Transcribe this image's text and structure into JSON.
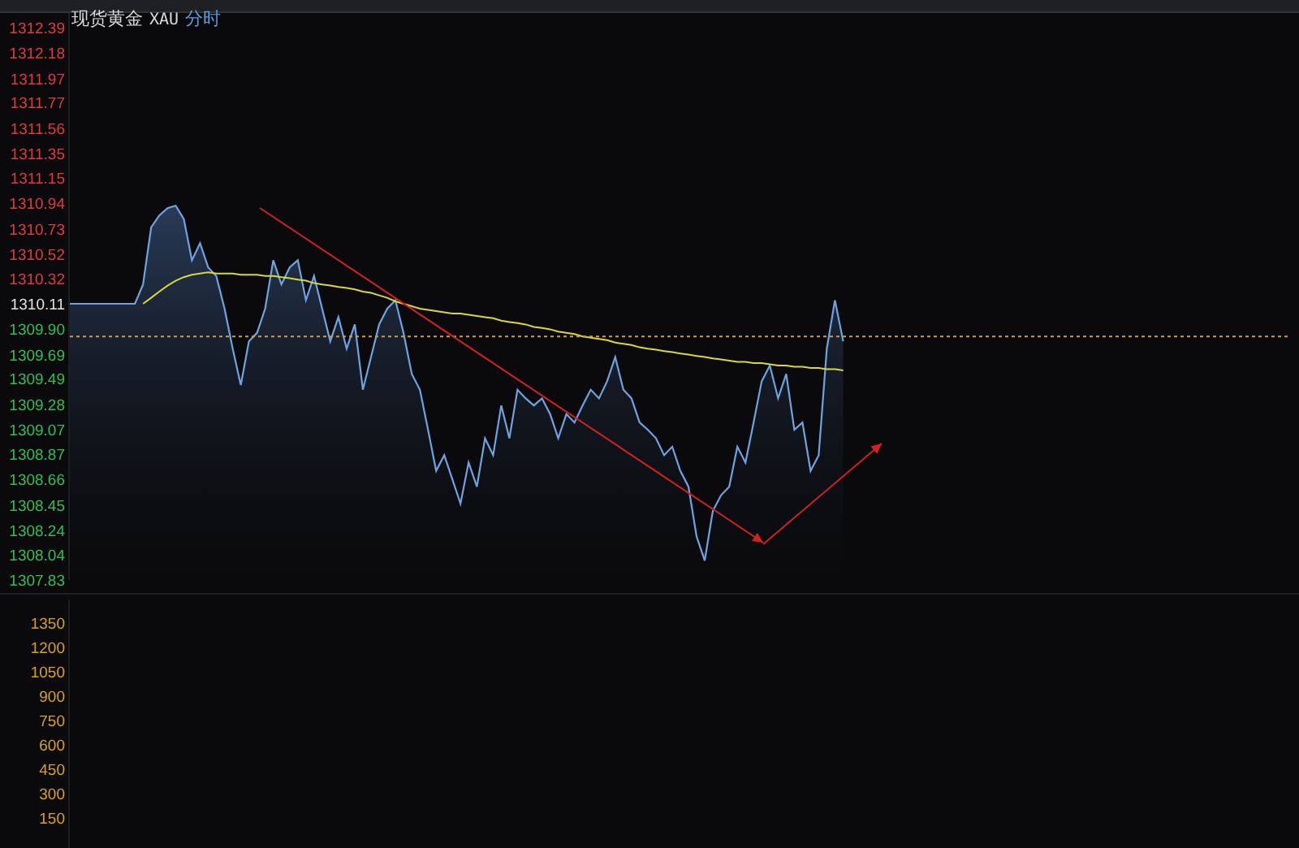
{
  "header": {
    "instrument": "现货黄金",
    "code": "XAU",
    "period": "分时"
  },
  "price_chart": {
    "chart_data": {
      "type": "line",
      "ylim": [
        1307.83,
        1312.39
      ],
      "categories": [
        null,
        null,
        null,
        null,
        null,
        null,
        null,
        null,
        null,
        null,
        null,
        null,
        null,
        null,
        null,
        null,
        null,
        null,
        null,
        null,
        null,
        null,
        null,
        null,
        null,
        null,
        null,
        null,
        null,
        null,
        null,
        null,
        null,
        null,
        null,
        null,
        null,
        null,
        null,
        null,
        null,
        null,
        null,
        null,
        null,
        null,
        null,
        null,
        null,
        null,
        null,
        null,
        null,
        null,
        null,
        null,
        null,
        null,
        null,
        null,
        null,
        null,
        null,
        null,
        null,
        null,
        null,
        null,
        null,
        null,
        null,
        null,
        null,
        null,
        null,
        null,
        null,
        null,
        null,
        null,
        null,
        null,
        null,
        null,
        null,
        null,
        null,
        null,
        null,
        null,
        null,
        null,
        null,
        null,
        null,
        null,
        null,
        null,
        null,
        null,
        null,
        null,
        null,
        null,
        null,
        null,
        null,
        null,
        null,
        null,
        null,
        null,
        null,
        null,
        null,
        null,
        null,
        null,
        null,
        null,
        null,
        null,
        null,
        null,
        null,
        null,
        null,
        null,
        null,
        null,
        null,
        null,
        null,
        null,
        null,
        null,
        null,
        null,
        null,
        null,
        null,
        null,
        null,
        null,
        null,
        null,
        null,
        null,
        null,
        null,
        null
      ],
      "yticks": [
        {
          "value": 1312.39,
          "label": "1312.39"
        },
        {
          "value": 1312.18,
          "label": "1312.18"
        },
        {
          "value": 1311.97,
          "label": "1311.97"
        },
        {
          "value": 1311.77,
          "label": "1311.77"
        },
        {
          "value": 1311.56,
          "label": "1311.56"
        },
        {
          "value": 1311.35,
          "label": "1311.35"
        },
        {
          "value": 1311.15,
          "label": "1311.15"
        },
        {
          "value": 1310.94,
          "label": "1310.94"
        },
        {
          "value": 1310.73,
          "label": "1310.73"
        },
        {
          "value": 1310.52,
          "label": "1310.52"
        },
        {
          "value": 1310.32,
          "label": "1310.32"
        },
        {
          "value": 1310.11,
          "label": "1310.11"
        },
        {
          "value": 1309.9,
          "label": "1309.90"
        },
        {
          "value": 1309.69,
          "label": "1309.69"
        },
        {
          "value": 1309.49,
          "label": "1309.49"
        },
        {
          "value": 1309.28,
          "label": "1309.28"
        },
        {
          "value": 1309.07,
          "label": "1309.07"
        },
        {
          "value": 1308.87,
          "label": "1308.87"
        },
        {
          "value": 1308.66,
          "label": "1308.66"
        },
        {
          "value": 1308.45,
          "label": "1308.45"
        },
        {
          "value": 1308.24,
          "label": "1308.24"
        },
        {
          "value": 1308.04,
          "label": "1308.04"
        },
        {
          "value": 1307.83,
          "label": "1307.83"
        }
      ],
      "series": [
        {
          "color": "#6fa3e0",
          "values": [
            1310.11,
            1310.11,
            1310.11,
            1310.11,
            1310.11,
            1310.11,
            1310.11,
            1310.11,
            1310.11,
            1310.27,
            1310.74,
            1310.84,
            1310.9,
            1310.92,
            1310.81,
            1310.47,
            1310.61,
            1310.41,
            1310.34,
            1310.07,
            1309.74,
            1309.44,
            1309.8,
            1309.87,
            1310.07,
            1310.47,
            1310.27,
            1310.41,
            1310.47,
            1310.14,
            1310.34,
            1310.07,
            1309.8,
            1310.0,
            1309.74,
            1309.94,
            1309.4,
            1309.67,
            1309.94,
            1310.07,
            1310.14,
            1309.87,
            1309.53,
            1309.4,
            1309.07,
            1308.73,
            1308.86,
            1308.66,
            1308.46,
            1308.8,
            1308.6,
            1309.0,
            1308.86,
            1309.27,
            1309.0,
            1309.4,
            1309.33,
            1309.27,
            1309.33,
            1309.2,
            1309.0,
            1309.2,
            1309.13,
            1309.27,
            1309.4,
            1309.33,
            1309.47,
            1309.67,
            1309.4,
            1309.33,
            1309.13,
            1309.07,
            1309.0,
            1308.86,
            1308.93,
            1308.73,
            1308.6,
            1308.19,
            1307.99,
            1308.4,
            1308.53,
            1308.6,
            1308.93,
            1308.8,
            1309.13,
            1309.47,
            1309.6,
            1309.33,
            1309.53,
            1309.07,
            1309.13,
            1308.73,
            1308.86,
            1309.74,
            1310.14,
            1309.8,
            null,
            null,
            null,
            null,
            null,
            null,
            null,
            null,
            null,
            null,
            null,
            null,
            null,
            null,
            null,
            null,
            null,
            null,
            null,
            null,
            null,
            null,
            null,
            null,
            null,
            null,
            null,
            null,
            null,
            null,
            null,
            null,
            null,
            null,
            null,
            null,
            null,
            null,
            null,
            null,
            null,
            null,
            null,
            null,
            null,
            null,
            null,
            null,
            null,
            null,
            null,
            null,
            null,
            null,
            null
          ]
        },
        {
          "color": "#d8d83a",
          "values": [
            null,
            null,
            null,
            null,
            null,
            null,
            null,
            null,
            null,
            1310.11,
            1310.16,
            1310.21,
            1310.26,
            1310.3,
            1310.33,
            1310.35,
            1310.36,
            1310.37,
            1310.36,
            1310.36,
            1310.36,
            1310.35,
            1310.35,
            1310.35,
            1310.34,
            1310.34,
            1310.33,
            1310.32,
            1310.31,
            1310.3,
            1310.28,
            1310.27,
            1310.26,
            1310.25,
            1310.24,
            1310.23,
            1310.21,
            1310.2,
            1310.18,
            1310.16,
            1310.13,
            1310.11,
            1310.09,
            1310.07,
            1310.06,
            1310.05,
            1310.04,
            1310.03,
            1310.03,
            1310.02,
            1310.01,
            1310.0,
            1309.99,
            1309.97,
            1309.96,
            1309.95,
            1309.94,
            1309.92,
            1309.91,
            1309.9,
            1309.88,
            1309.87,
            1309.86,
            1309.84,
            1309.83,
            1309.82,
            1309.81,
            1309.79,
            1309.78,
            1309.77,
            1309.75,
            1309.74,
            1309.73,
            1309.72,
            1309.71,
            1309.7,
            1309.69,
            1309.68,
            1309.67,
            1309.66,
            1309.65,
            1309.64,
            1309.63,
            1309.63,
            1309.62,
            1309.62,
            1309.61,
            1309.6,
            1309.6,
            1309.59,
            1309.59,
            1309.58,
            1309.58,
            1309.57,
            1309.57,
            1309.56,
            null,
            null,
            null,
            null,
            null,
            null,
            null,
            null,
            null,
            null,
            null,
            null,
            null,
            null,
            null,
            null,
            null,
            null,
            null,
            null,
            null,
            null,
            null,
            null,
            null,
            null,
            null,
            null,
            null,
            null,
            null,
            null,
            null,
            null,
            null,
            null,
            null,
            null,
            null,
            null,
            null,
            null,
            null,
            null,
            null,
            null,
            null,
            null,
            null,
            null,
            null,
            null,
            null,
            null,
            null
          ]
        },
        {
          "color": "#d89a30",
          "line_style": "dashed",
          "values": [
            1309.84,
            1309.84,
            1309.84,
            1309.84,
            1309.84,
            1309.84,
            1309.84,
            1309.84,
            1309.84,
            1309.84,
            1309.84,
            1309.84,
            1309.84,
            1309.84,
            1309.84,
            1309.84,
            1309.84,
            1309.84,
            1309.84,
            1309.84,
            1309.84,
            1309.84,
            1309.84,
            1309.84,
            1309.84,
            1309.84,
            1309.84,
            1309.84,
            1309.84,
            1309.84,
            1309.84,
            1309.84,
            1309.84,
            1309.84,
            1309.84,
            1309.84,
            1309.84,
            1309.84,
            1309.84,
            1309.84,
            1309.84,
            1309.84,
            1309.84,
            1309.84,
            1309.84,
            1309.84,
            1309.84,
            1309.84,
            1309.84,
            1309.84,
            1309.84,
            1309.84,
            1309.84,
            1309.84,
            1309.84,
            1309.84,
            1309.84,
            1309.84,
            1309.84,
            1309.84,
            1309.84,
            1309.84,
            1309.84,
            1309.84,
            1309.84,
            1309.84,
            1309.84,
            1309.84,
            1309.84,
            1309.84,
            1309.84,
            1309.84,
            1309.84,
            1309.84,
            1309.84,
            1309.84,
            1309.84,
            1309.84,
            1309.84,
            1309.84,
            1309.84,
            1309.84,
            1309.84,
            1309.84,
            1309.84,
            1309.84,
            1309.84,
            1309.84,
            1309.84,
            1309.84,
            1309.84,
            1309.84,
            1309.84,
            1309.84,
            1309.84,
            1309.84,
            1309.84,
            1309.84,
            1309.84,
            1309.84,
            1309.84,
            1309.84,
            1309.84,
            1309.84,
            1309.84,
            1309.84,
            1309.84,
            1309.84,
            1309.84,
            1309.84,
            1309.84,
            1309.84,
            1309.84,
            1309.84,
            1309.84,
            1309.84,
            1309.84,
            1309.84,
            1309.84,
            1309.84,
            1309.84,
            1309.84,
            1309.84,
            1309.84,
            1309.84,
            1309.84,
            1309.84,
            1309.84,
            1309.84,
            1309.84,
            1309.84,
            1309.84,
            1309.84,
            1309.84,
            1309.84,
            1309.84,
            1309.84,
            1309.84,
            1309.84,
            1309.84,
            1309.84,
            1309.84,
            1309.84,
            1309.84,
            1309.84,
            1309.84,
            1309.84,
            1309.84,
            1309.84,
            1309.84,
            1309.84
          ]
        }
      ]
    }
  },
  "volume_pane": {
    "yticks": [
      "1350",
      "1200",
      "1050",
      "900",
      "750",
      "600",
      "450",
      "300",
      "150"
    ]
  }
}
